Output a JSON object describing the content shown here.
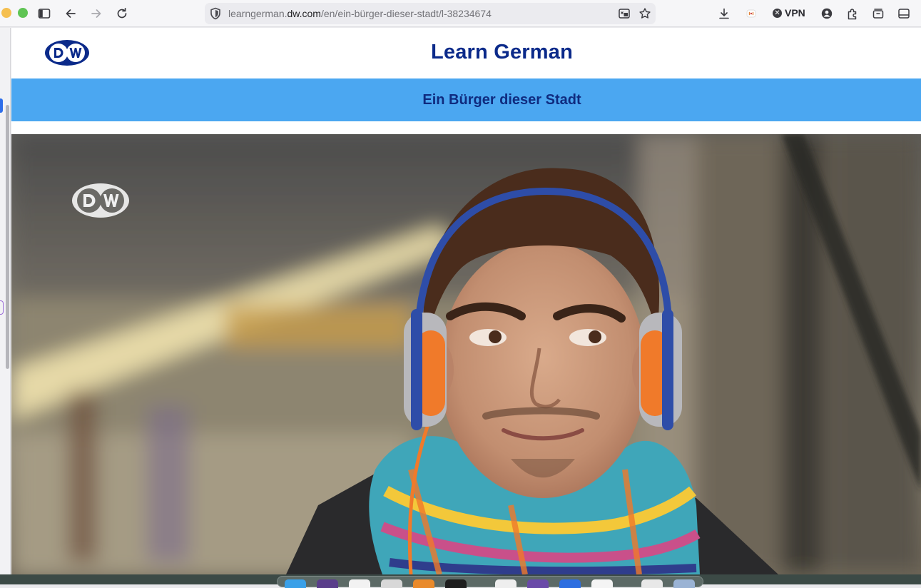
{
  "browser": {
    "url_prefix": "learngerman.",
    "url_host": "dw.com",
    "url_path": "/en/ein-bürger-dieser-stadt/l-38234674",
    "vpn_label": "VPN"
  },
  "page": {
    "logo_text": "DW",
    "site_title": "Learn German",
    "lesson_title": "Ein Bürger dieser Stadt",
    "video_watermark": "DW"
  },
  "colors": {
    "title_navy": "#0b2a8a",
    "lesson_bar_blue": "#4ba7f1",
    "headphone_orange": "#f07a2a"
  },
  "icons": {
    "sidebar_toggle": "sidebar-icon",
    "back": "arrow-left-icon",
    "forward": "arrow-right-icon",
    "reload": "reload-icon",
    "site_security": "shield-icon",
    "reader": "reader-view-icon",
    "bookmark": "star-icon",
    "downloads": "download-icon",
    "extension_badge": "extension-badge-icon",
    "account": "account-icon",
    "extensions": "puzzle-icon",
    "tab_container": "container-icon",
    "sidebar_right": "panel-icon"
  }
}
